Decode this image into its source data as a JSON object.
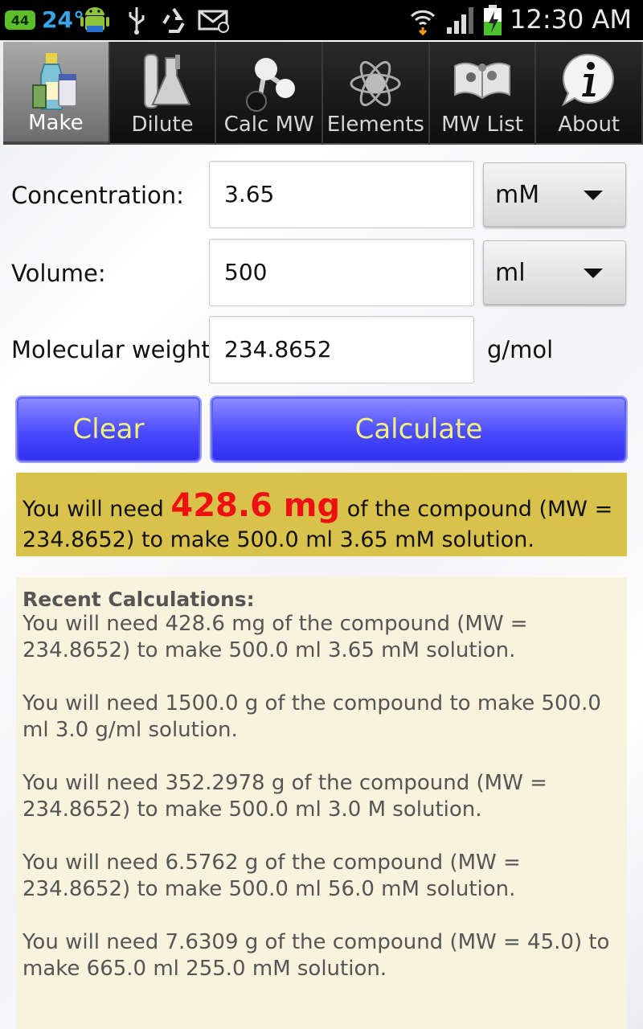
{
  "status_bar": {
    "badge": "44",
    "temperature": "24°",
    "time": "12:30 AM",
    "icons": [
      "android-icon",
      "usb-icon",
      "recycle-icon",
      "email-icon",
      "wifi-icon",
      "signal-icon",
      "battery-charging-icon"
    ]
  },
  "tabs": [
    {
      "label": "Make",
      "icon": "bottles-icon",
      "active": true
    },
    {
      "label": "Dilute",
      "icon": "flask-icon",
      "active": false
    },
    {
      "label": "Calc MW",
      "icon": "molecule-icon",
      "active": false
    },
    {
      "label": "Elements",
      "icon": "atom-icon",
      "active": false
    },
    {
      "label": "MW List",
      "icon": "book-icon",
      "active": false
    },
    {
      "label": "About",
      "icon": "info-icon",
      "active": false
    }
  ],
  "form": {
    "concentration_label": "Concentration:",
    "concentration_value": "3.65",
    "concentration_unit": "mM",
    "volume_label": "Volume:",
    "volume_value": "500",
    "volume_unit": "ml",
    "mw_label": "Molecular weight:",
    "mw_value": "234.8652",
    "mw_unit": "g/mol"
  },
  "buttons": {
    "clear": "Clear",
    "calculate": "Calculate"
  },
  "result": {
    "prefix": "You will need ",
    "amount": "428.6 mg",
    "suffix": " of the compound (MW = 234.8652) to make 500.0 ml 3.65 mM solution."
  },
  "recent": {
    "title": "Recent Calculations:",
    "items": [
      "You will need 428.6 mg of the compound (MW = 234.8652) to make 500.0 ml 3.65 mM solution.",
      "You will need 1500.0 g of the compound to make 500.0 ml 3.0 g/ml solution.",
      "You will need 352.2978 g of the compound (MW = 234.8652) to make 500.0 ml 3.0 M solution.",
      "You will need 6.5762 g of the compound (MW = 234.8652) to make 500.0 ml 56.0 mM solution.",
      "You will need 7.6309 g of the compound (MW = 45.0) to make 665.0 ml 255.0 mM solution."
    ]
  },
  "colors": {
    "result_bg": "#d9c24b",
    "result_amount": "#ee1111",
    "button_text": "#f3f07a",
    "button_bg": "#4b4bff",
    "recent_bg": "#f7f3dc"
  }
}
